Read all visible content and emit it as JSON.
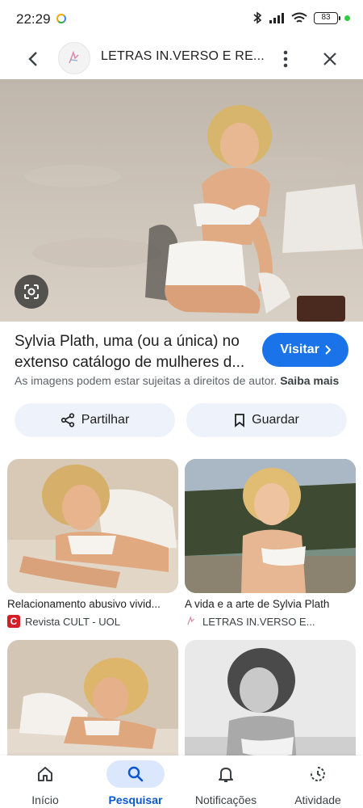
{
  "status_bar": {
    "time": "22:29",
    "battery": "83"
  },
  "topbar": {
    "back_icon": "arrow-back-icon",
    "site_title": "LETRAS IN.VERSO E RE...",
    "more_icon": "more-vert-icon",
    "close_icon": "close-icon"
  },
  "result": {
    "title_line1": "Sylvia Plath, uma (ou a única) no",
    "title_line2": "extenso catálogo de mulheres d...",
    "visit_label": "Visitar",
    "copyright_text": "As imagens podem estar sujeitas a direitos de autor.",
    "learn_more": "Saiba mais"
  },
  "actions": {
    "share_label": "Partilhar",
    "save_label": "Guardar"
  },
  "related": [
    {
      "title": "Relacionamento abusivo vivid...",
      "source": "Revista CULT - UOL"
    },
    {
      "title": "A vida e a arte de Sylvia Plath",
      "source": "LETRAS IN.VERSO E..."
    },
    {
      "title": "",
      "source": ""
    },
    {
      "title": "",
      "source": ""
    }
  ],
  "bottom_nav": [
    {
      "label": "Início",
      "icon": "home-icon",
      "active": false
    },
    {
      "label": "Pesquisar",
      "icon": "search-icon",
      "active": true
    },
    {
      "label": "Notificações",
      "icon": "bell-icon",
      "active": false
    },
    {
      "label": "Atividade",
      "icon": "history-icon",
      "active": false
    }
  ],
  "colors": {
    "accent": "#1a73e8",
    "pill_bg": "#eef2fb",
    "nav_active": "#0b57d0"
  }
}
